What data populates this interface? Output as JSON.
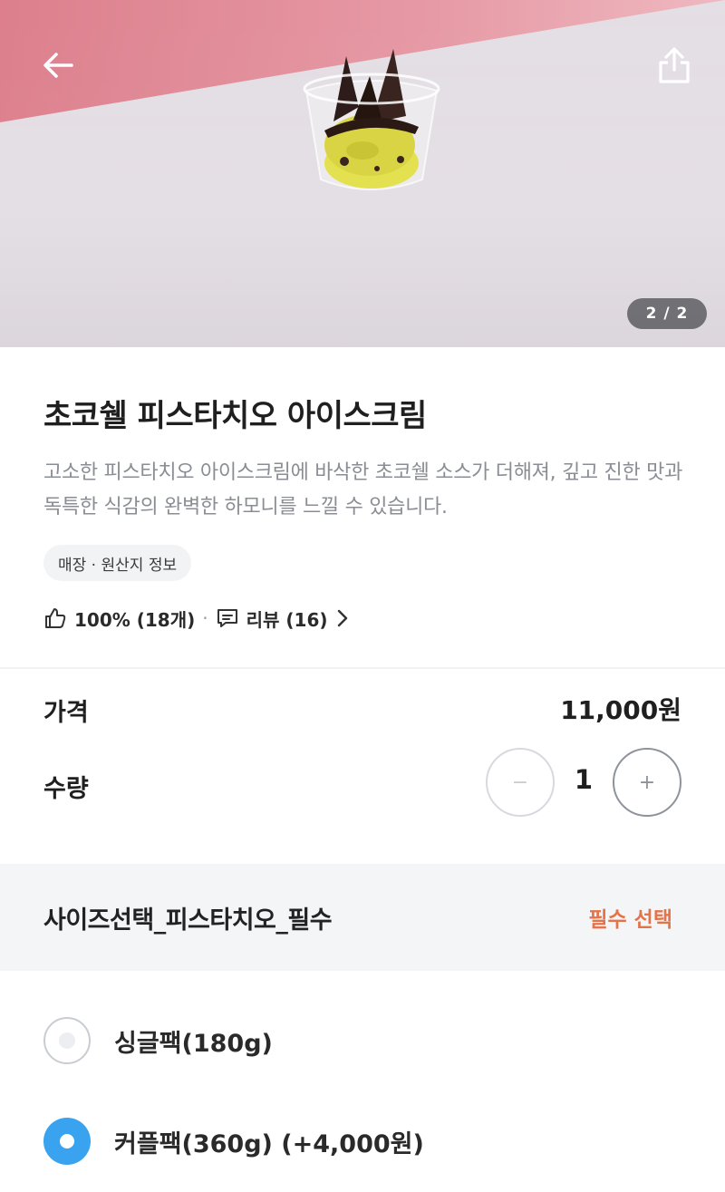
{
  "hero": {
    "counter": "2 / 2"
  },
  "icons": {
    "back": "arrow-left-icon",
    "share": "share-icon",
    "like": "thumbs-up-icon",
    "review": "chat-bubble-icon",
    "chevron": "chevron-right-icon"
  },
  "product": {
    "title": "초코쉘 피스타치오 아이스크림",
    "description": "고소한 피스타치오 아이스크림에 바삭한 초코쉘 소스가 더해져, 깊고 진한 맛과 독특한 식감의 완벽한 하모니를 느낄 수 있습니다.",
    "origin_chip": "매장 · 원산지 정보",
    "rating_text": "100% (18개)",
    "review_text": "리뷰 (16)"
  },
  "order": {
    "price_label": "가격",
    "price_value": "11,000원",
    "qty_label": "수량",
    "qty_value": "1",
    "minus_label": "−",
    "plus_label": "+"
  },
  "options": {
    "title": "사이즈선택_피스타치오_필수",
    "required_text": "필수 선택",
    "items": [
      {
        "label": "싱글팩(180g)",
        "selected": false
      },
      {
        "label": "커플팩(360g) (+4,000원)",
        "selected": true
      }
    ]
  },
  "colors": {
    "accent_orange": "#e5734a",
    "radio_blue": "#3aa3ef",
    "hero_pink": "#e0828f"
  }
}
